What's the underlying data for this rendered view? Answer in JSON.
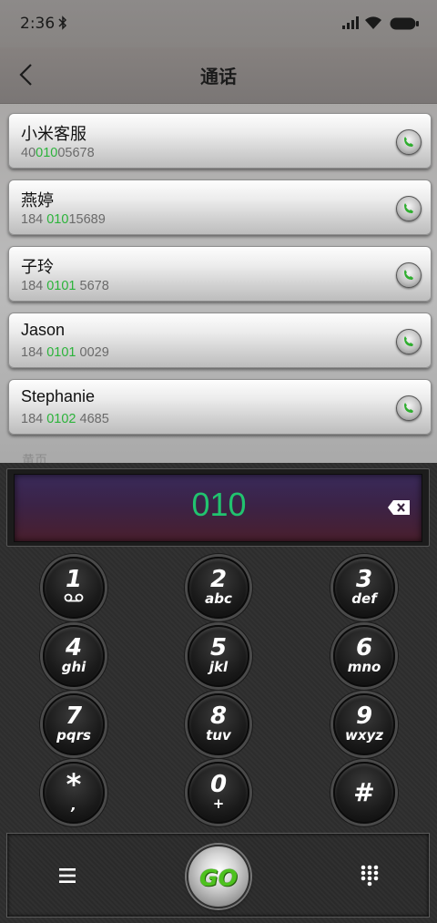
{
  "status_bar": {
    "time": "2:36"
  },
  "header": {
    "title": "通话"
  },
  "contacts": [
    {
      "name": "小米客服",
      "number_pre": "40",
      "number_match": "010",
      "number_post": "05678"
    },
    {
      "name": "燕婷",
      "number_pre": "184 ",
      "number_match": "010",
      "number_post": "15689"
    },
    {
      "name": "子玲",
      "number_pre": "184 ",
      "number_match": "0101",
      "number_post": " 5678"
    },
    {
      "name": "Jason",
      "number_pre": "184 ",
      "number_match": "0101",
      "number_post": " 0029"
    },
    {
      "name": "Stephanie",
      "number_pre": "184 ",
      "number_match": "0102",
      "number_post": " 4685"
    }
  ],
  "section_peek": "黄页",
  "dialer": {
    "digits": "010",
    "keys": [
      {
        "digit": "1",
        "letters": ""
      },
      {
        "digit": "2",
        "letters": "abc"
      },
      {
        "digit": "3",
        "letters": "def"
      },
      {
        "digit": "4",
        "letters": "ghi"
      },
      {
        "digit": "5",
        "letters": "jkl"
      },
      {
        "digit": "6",
        "letters": "mno"
      },
      {
        "digit": "7",
        "letters": "pqrs"
      },
      {
        "digit": "8",
        "letters": "tuv"
      },
      {
        "digit": "9",
        "letters": "wxyz"
      },
      {
        "digit": "*",
        "letters": ","
      },
      {
        "digit": "0",
        "letters": "+"
      },
      {
        "digit": "#",
        "letters": ""
      }
    ],
    "go_label": "GO"
  },
  "colors": {
    "match_highlight": "#2bb33a",
    "dial_digits": "#21c36f",
    "go_text": "#4ec21f"
  },
  "icons": [
    "bluetooth-icon",
    "signal-icon",
    "wifi-icon",
    "battery-icon",
    "back-icon",
    "call-icon",
    "backspace-icon",
    "voicemail-icon",
    "menu-icon",
    "keypad-icon"
  ]
}
